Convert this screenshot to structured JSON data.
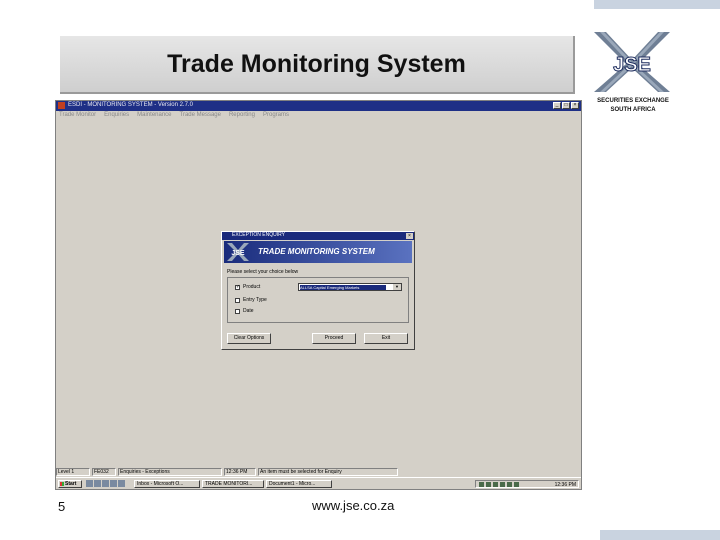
{
  "slide": {
    "title": "Trade Monitoring System",
    "page_number": "5",
    "url": "www.jse.co.za"
  },
  "logo": {
    "letters": "JSE",
    "line1": "SECURITIES EXCHANGE",
    "line2": "SOUTH AFRICA"
  },
  "app": {
    "window_title": "ESDI - MONITORING SYSTEM - Version 2.7.0",
    "menu": [
      "Trade Monitor",
      "Enquiries",
      "Maintenance",
      "Trade Message",
      "Reporting",
      "Programs"
    ],
    "window_buttons": [
      "_",
      "□",
      "×"
    ]
  },
  "dialog": {
    "title": "EXCEPTION ENQUIRY",
    "close": "×",
    "banner_logo": "JSE",
    "banner_text": "TRADE MONITORING SYSTEM",
    "prompt": "Please select your choice below",
    "options": [
      {
        "label": "Product",
        "checked": true
      },
      {
        "label": "Entry Type",
        "checked": false
      },
      {
        "label": "Date",
        "checked": false
      }
    ],
    "select_value": "ALLSA Capital Emerging Markets",
    "select_arrow": "▼",
    "buttons": {
      "clear": "Clear Options",
      "proceed": "Proceed",
      "exit": "Exit"
    }
  },
  "statusbar": [
    "Level 1",
    "FE032",
    "Enquiries - Exceptions",
    "12:36 PM",
    "An item must be selected for Enquiry"
  ],
  "taskbar": {
    "start": "Start",
    "tasks": [
      "Inbox - Microsoft O...",
      "TRADE MONITORI...",
      "Document1 - Micro..."
    ],
    "clock": "12:36 PM"
  },
  "colors": {
    "titlebar": "#1e2f86",
    "window_bg": "#d4d0c8",
    "accent_bar": "#c9d3e0"
  }
}
